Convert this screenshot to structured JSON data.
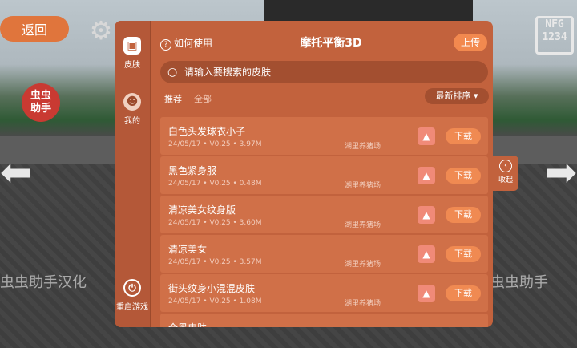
{
  "background": {
    "back_label": "返回",
    "badge_text": "虫虫\n助手",
    "watermark_left": "虫虫助手汉化",
    "watermark_right": "虫虫助手",
    "plate_text": "NFG\n1234"
  },
  "sidebar": {
    "items": [
      {
        "label": "皮肤",
        "icon": "skin-icon"
      },
      {
        "label": "我的",
        "icon": "face-icon"
      },
      {
        "label": "重启游戏",
        "icon": "power-icon"
      }
    ]
  },
  "header": {
    "help_label": "如何使用",
    "title": "摩托平衡3D",
    "upload_label": "上传"
  },
  "search": {
    "placeholder": "请输入要搜索的皮肤"
  },
  "tabs": {
    "recommended": "推荐",
    "all": "全部"
  },
  "sort": {
    "label": "最新排序"
  },
  "download_label": "下载",
  "collapse_label": "收起",
  "skins": [
    {
      "name": "白色头发球衣小子",
      "date": "24/05/17",
      "version": "V0.25",
      "size": "3.97M",
      "author": "湖里养猪场"
    },
    {
      "name": "黑色紧身服",
      "date": "24/05/17",
      "version": "V0.25",
      "size": "0.48M",
      "author": "湖里养猪场"
    },
    {
      "name": "清凉美女纹身版",
      "date": "24/05/17",
      "version": "V0.25",
      "size": "3.60M",
      "author": "湖里养猪场"
    },
    {
      "name": "清凉美女",
      "date": "24/05/17",
      "version": "V0.25",
      "size": "3.57M",
      "author": "湖里养猪场"
    },
    {
      "name": "街头纹身小混混皮肤",
      "date": "24/05/17",
      "version": "V0.25",
      "size": "1.08M",
      "author": "湖里养猪场"
    },
    {
      "name": "全黑皮肤",
      "date": "",
      "version": "",
      "size": "",
      "author": ""
    }
  ],
  "skin_meta": [
    "24/05/17 • V0.25 • 3.97M",
    "24/05/17 • V0.25 • 0.48M",
    "24/05/17 • V0.25 • 3.60M",
    "24/05/17 • V0.25 • 3.57M",
    "24/05/17 • V0.25 • 1.08M",
    ""
  ]
}
